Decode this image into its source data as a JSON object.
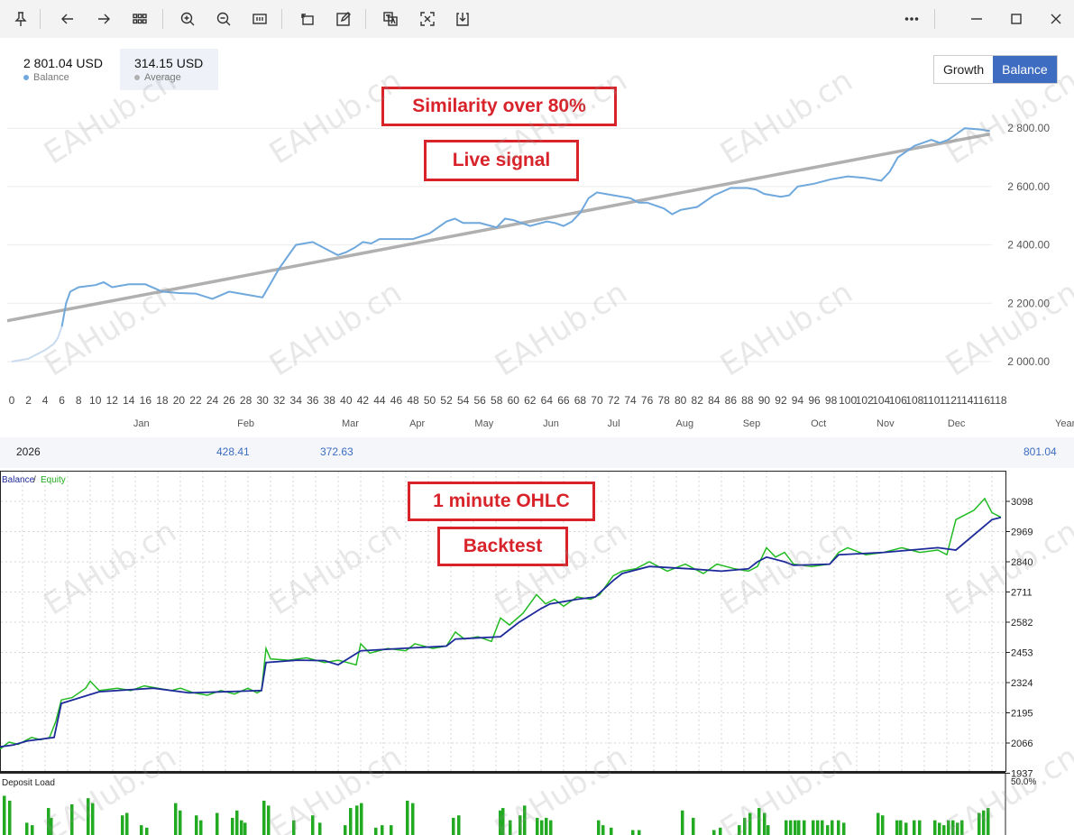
{
  "toolbar": {
    "icons": [
      "pin-icon",
      "back-arrow-icon",
      "forward-arrow-icon",
      "grid-icon",
      "zoom-in-icon",
      "zoom-out-icon",
      "fit-page-icon",
      "rotate-icon",
      "edit-icon",
      "translate-icon",
      "crop-icon",
      "save-icon",
      "more-icon",
      "minimize-icon",
      "maximize-icon",
      "close-icon"
    ]
  },
  "stats": {
    "balance_value": "2 801.04 USD",
    "balance_label": "Balance",
    "average_value": "314.15 USD",
    "average_label": "Average"
  },
  "toggle": {
    "growth": "Growth",
    "balance": "Balance"
  },
  "callouts": {
    "similarity": "Similarity over 80%",
    "live": "Live signal",
    "ohlc": "1 minute OHLC",
    "backtest": "Backtest"
  },
  "summary": {
    "year": "2026",
    "jan": "428.41",
    "feb": "372.63",
    "total": "801.04"
  },
  "watermark": "EAHub.cn",
  "colors": {
    "balance_line": "#6fa8dc",
    "average_line": "#b0b0b0",
    "accent": "#3d6cc0",
    "callout": "#d8232a",
    "equity": "#22bb22",
    "bt_balance": "#1e2a9a",
    "deposit_load": "#22aa22"
  },
  "chart_data": [
    {
      "type": "line",
      "title": "",
      "xlabel": "",
      "ylabel": "",
      "x_ticks": [
        0,
        2,
        4,
        6,
        8,
        10,
        12,
        14,
        16,
        18,
        20,
        22,
        24,
        26,
        28,
        30,
        32,
        34,
        36,
        38,
        40,
        42,
        44,
        46,
        48,
        50,
        52,
        54,
        56,
        58,
        60,
        62,
        64,
        66,
        68,
        70,
        72,
        74,
        76,
        78,
        80,
        82,
        84,
        86,
        88,
        90,
        92,
        94,
        96,
        98,
        100,
        102,
        104,
        106,
        108,
        110,
        112,
        114,
        116,
        118
      ],
      "months": [
        "Jan",
        "Feb",
        "Mar",
        "Apr",
        "May",
        "Jun",
        "Jul",
        "Aug",
        "Sep",
        "Oct",
        "Nov",
        "Dec",
        "Year"
      ],
      "month_positions": [
        15.5,
        28,
        40.5,
        48.5,
        56.5,
        64.5,
        72,
        80.5,
        88.5,
        96.5,
        104.5,
        113,
        126
      ],
      "xlim": [
        0,
        118
      ],
      "ylim": [
        1900,
        2900
      ],
      "y_ticks": [
        "2 000.00",
        "2 200.00",
        "2 400.00",
        "2 600.00",
        "2 800.00"
      ],
      "y_tick_values": [
        2000,
        2200,
        2400,
        2600,
        2800
      ],
      "series": [
        {
          "name": "Balance",
          "x": [
            0,
            2,
            4,
            5,
            5.5,
            6,
            6.5,
            7,
            8,
            10,
            11,
            12,
            14,
            16,
            18,
            20,
            22,
            24,
            26,
            28,
            30,
            31,
            32,
            33,
            34,
            36,
            38,
            39,
            40,
            41,
            42,
            43,
            44,
            46,
            48,
            50,
            52,
            53,
            54,
            56,
            58,
            59,
            60,
            62,
            64,
            65,
            66,
            67,
            68,
            69,
            70,
            72,
            74,
            75,
            76,
            78,
            79,
            80,
            82,
            84,
            86,
            88,
            89,
            90,
            92,
            93,
            94,
            96,
            98,
            100,
            102,
            104,
            105,
            106,
            108,
            110,
            111,
            112,
            113,
            114,
            116,
            117
          ],
          "y": [
            2000,
            2010,
            2040,
            2060,
            2080,
            2120,
            2200,
            2240,
            2255,
            2262,
            2272,
            2255,
            2265,
            2265,
            2240,
            2235,
            2233,
            2215,
            2240,
            2230,
            2220,
            2270,
            2320,
            2360,
            2400,
            2410,
            2380,
            2365,
            2375,
            2390,
            2410,
            2405,
            2420,
            2420,
            2420,
            2440,
            2480,
            2490,
            2475,
            2475,
            2460,
            2490,
            2485,
            2465,
            2480,
            2475,
            2465,
            2480,
            2510,
            2560,
            2580,
            2570,
            2560,
            2545,
            2545,
            2525,
            2505,
            2520,
            2530,
            2570,
            2595,
            2595,
            2590,
            2575,
            2565,
            2570,
            2600,
            2610,
            2625,
            2635,
            2630,
            2620,
            2650,
            2700,
            2740,
            2760,
            2750,
            2760,
            2780,
            2800,
            2795,
            2790
          ]
        },
        {
          "name": "Average",
          "x": [
            0,
            117
          ],
          "y": [
            2140,
            2780
          ]
        }
      ]
    },
    {
      "type": "line",
      "title": "",
      "legend": [
        "Balance",
        "Equity"
      ],
      "xlim": [
        0,
        1115
      ],
      "ylim": [
        1937,
        3150
      ],
      "y_ticks": [
        "3098",
        "2969",
        "2840",
        "2711",
        "2582",
        "2453",
        "2324",
        "2195",
        "2066",
        "1937"
      ],
      "y_tick_values": [
        3098,
        2969,
        2840,
        2711,
        2582,
        2453,
        2324,
        2195,
        2066,
        1937
      ],
      "series": [
        {
          "name": "Balance",
          "x": [
            0,
            15,
            30,
            60,
            68,
            110,
            170,
            210,
            290,
            295,
            330,
            360,
            375,
            400,
            445,
            495,
            505,
            555,
            575,
            600,
            610,
            640,
            660,
            680,
            690,
            720,
            765,
            800,
            830,
            840,
            850,
            870,
            880,
            920,
            930,
            980,
            1040,
            1060,
            1100,
            1110
          ],
          "y": [
            2050,
            2058,
            2075,
            2090,
            2235,
            2285,
            2300,
            2280,
            2290,
            2410,
            2420,
            2418,
            2400,
            2460,
            2470,
            2480,
            2510,
            2520,
            2580,
            2640,
            2660,
            2680,
            2690,
            2760,
            2790,
            2820,
            2810,
            2800,
            2810,
            2840,
            2860,
            2840,
            2825,
            2830,
            2870,
            2880,
            2900,
            2890,
            3020,
            3030
          ]
        },
        {
          "name": "Equity",
          "x": [
            0,
            10,
            20,
            35,
            45,
            55,
            62,
            68,
            80,
            95,
            100,
            110,
            130,
            145,
            160,
            175,
            190,
            200,
            215,
            230,
            245,
            260,
            275,
            285,
            290,
            295,
            300,
            320,
            340,
            360,
            375,
            395,
            400,
            410,
            430,
            450,
            460,
            480,
            495,
            505,
            515,
            530,
            545,
            555,
            565,
            580,
            595,
            605,
            615,
            625,
            640,
            655,
            665,
            680,
            690,
            705,
            720,
            740,
            760,
            780,
            795,
            815,
            830,
            840,
            850,
            860,
            870,
            880,
            900,
            920,
            930,
            940,
            960,
            980,
            1000,
            1020,
            1040,
            1050,
            1060,
            1070,
            1080,
            1092,
            1100,
            1110
          ],
          "y": [
            2040,
            2070,
            2060,
            2090,
            2080,
            2090,
            2160,
            2250,
            2260,
            2300,
            2330,
            2290,
            2300,
            2290,
            2310,
            2300,
            2290,
            2300,
            2280,
            2270,
            2290,
            2275,
            2300,
            2280,
            2290,
            2470,
            2425,
            2420,
            2430,
            2410,
            2420,
            2400,
            2490,
            2450,
            2470,
            2460,
            2490,
            2470,
            2480,
            2540,
            2510,
            2520,
            2500,
            2600,
            2570,
            2620,
            2700,
            2660,
            2680,
            2650,
            2690,
            2680,
            2700,
            2780,
            2800,
            2810,
            2840,
            2800,
            2830,
            2790,
            2830,
            2810,
            2800,
            2820,
            2900,
            2860,
            2880,
            2830,
            2820,
            2830,
            2880,
            2900,
            2870,
            2880,
            2900,
            2880,
            2890,
            2870,
            3020,
            3040,
            3060,
            3110,
            3050,
            3030
          ]
        }
      ]
    },
    {
      "type": "bar",
      "title": "Deposit Load",
      "ylim": [
        0,
        50
      ],
      "y_tick_label": "50.0%",
      "x": [
        3,
        9,
        28,
        34,
        52,
        55,
        78,
        96,
        101,
        134,
        139,
        155,
        161,
        193,
        198,
        216,
        221,
        239,
        256,
        261,
        266,
        270,
        291,
        296,
        324,
        345,
        353,
        381,
        387,
        394,
        399,
        415,
        422,
        432,
        450,
        456,
        501,
        507,
        553,
        556,
        564,
        575,
        580,
        594,
        599,
        604,
        609,
        662,
        667,
        676,
        700,
        707,
        755,
        767,
        790,
        797,
        818,
        824,
        830,
        840,
        846,
        850,
        870,
        875,
        880,
        884,
        890,
        900,
        905,
        910,
        916,
        921,
        928,
        934,
        972,
        977,
        993,
        997,
        1003,
        1012,
        1018,
        1035,
        1040,
        1045,
        1050,
        1055,
        1060,
        1065,
        1084,
        1089,
        1094
      ],
      "values": [
        32,
        28,
        10,
        8,
        22,
        14,
        25,
        30,
        26,
        16,
        18,
        8,
        6,
        26,
        20,
        16,
        12,
        18,
        14,
        20,
        12,
        10,
        28,
        24,
        12,
        16,
        10,
        8,
        22,
        24,
        26,
        6,
        8,
        8,
        28,
        26,
        14,
        16,
        20,
        22,
        12,
        16,
        24,
        14,
        12,
        14,
        12,
        12,
        8,
        6,
        4,
        4,
        20,
        14,
        4,
        6,
        8,
        14,
        18,
        22,
        18,
        8,
        12,
        12,
        12,
        12,
        12,
        12,
        12,
        12,
        8,
        12,
        12,
        10,
        18,
        16,
        12,
        12,
        10,
        12,
        12,
        12,
        10,
        8,
        12,
        12,
        10,
        12,
        18,
        20,
        22
      ]
    }
  ]
}
